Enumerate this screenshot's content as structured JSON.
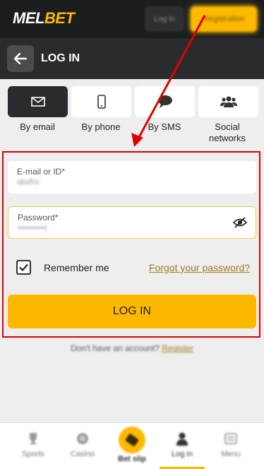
{
  "header": {
    "logo_part1": "MEL",
    "logo_part2": "BET",
    "login_label": "Log in",
    "register_label": "Registration"
  },
  "subheader": {
    "title": "LOG IN"
  },
  "tabs": [
    {
      "label": "By email",
      "icon": "envelope-icon",
      "active": true
    },
    {
      "label": "By phone",
      "icon": "phone-icon",
      "active": false
    },
    {
      "label": "By SMS",
      "icon": "chat-bubble-icon",
      "active": false
    },
    {
      "label": "Social networks",
      "icon": "people-icon",
      "active": false
    }
  ],
  "form": {
    "email_label": "E-mail or ID*",
    "email_value": "aksfhs",
    "password_label": "Password*",
    "password_value": "••••••••••|",
    "remember_label": "Remember me",
    "remember_checked": true,
    "forgot_label": "Forgot your password?",
    "submit_label": "LOG IN"
  },
  "no_account": {
    "text": "Don't have an account?",
    "link": "Register"
  },
  "bottom_nav": [
    {
      "label": "Sports",
      "icon": "trophy-icon"
    },
    {
      "label": "Casino",
      "icon": "chip-icon"
    },
    {
      "label": "Bet slip",
      "icon": "ticket-icon"
    },
    {
      "label": "Log in",
      "icon": "user-icon"
    },
    {
      "label": "Menu",
      "icon": "menu-icon"
    }
  ],
  "colors": {
    "accent": "#fdb900",
    "annotation": "#e00000",
    "dark": "#1c1d1f"
  }
}
